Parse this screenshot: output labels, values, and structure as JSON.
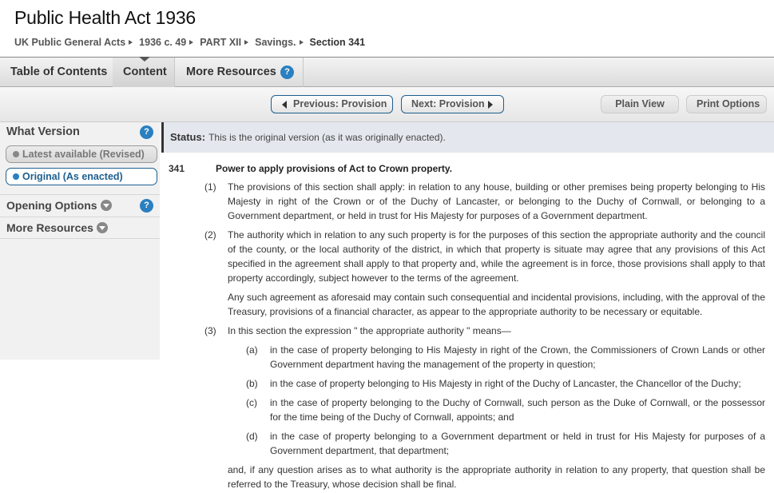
{
  "header": {
    "title": "Public Health Act 1936"
  },
  "breadcrumb": [
    "UK Public General Acts",
    "1936 c. 49",
    "PART XII",
    "Savings.",
    "Section 341"
  ],
  "tabs": {
    "toc": "Table of Contents",
    "content": "Content",
    "more": "More Resources",
    "help": "?"
  },
  "nav": {
    "previous": "Previous: Provision",
    "next": "Next: Provision",
    "plain": "Plain View",
    "print": "Print Options"
  },
  "sidebar": {
    "what_version": "What Version",
    "latest": "Latest available (Revised)",
    "original": "Original (As enacted)",
    "opening_options": "Opening Options",
    "more_resources": "More Resources",
    "help": "?"
  },
  "status": {
    "label": "Status:",
    "text": "This is the original version (as it was originally enacted)."
  },
  "section": {
    "number": "341",
    "heading": "Power to apply provisions of Act to Crown property.",
    "s1_num": "(1)",
    "s1": "The provisions of this section shall apply: in relation to any house, building or other premises being property belonging to His Majesty in right of the Crown or of the Duchy of Lancaster, or belonging to the Duchy of Cornwall, or belonging to a Government department, or held in trust for His Majesty for purposes of a Government department.",
    "s2_num": "(2)",
    "s2": "The authority which in relation to any such property is for the purposes of this section the appropriate authority and the council of the county, or the local authority of the district, in which that property is situate may agree that any provisions of this Act specified in the agreement shall apply to that property and, while the agreement is in force, those provisions shall apply to that property accordingly, subject however to the terms of the agreement.",
    "s2b": "Any such agreement as aforesaid may contain such consequential and incidental provisions, including, with the approval of the Treasury, provisions of a financial character, as appear to the appropriate authority to be necessary or equitable.",
    "s3_num": "(3)",
    "s3": "In this section the expression \" the appropriate authority \" means—",
    "a_num": "(a)",
    "a": "in the case of property belonging to His Majesty in right of the Crown, the Commissioners of Crown Lands or other Government department having the management of the property in question;",
    "b_num": "(b)",
    "b": "in the case of property belonging to His Majesty in right of the Duchy of Lancaster, the Chancellor of the Duchy;",
    "c_num": "(c)",
    "c": "in the case of property belonging to the Duchy of Cornwall, such person as the Duke of Cornwall, or the possessor for the time being of the Duchy of Cornwall, appoints; and",
    "d_num": "(d)",
    "d": "in the case of property belonging to a Government department or held in trust for His Majesty for purposes of a Government department, that department;",
    "closing": "and, if any question arises as to what authority is the appropriate authority in relation to any property, that question shall be referred to the Treasury, whose decision shall be final."
  },
  "colors": {
    "accent": "#2a7fc1",
    "border_blue": "#1e5f8f",
    "status_bg": "#e4e8ee"
  }
}
